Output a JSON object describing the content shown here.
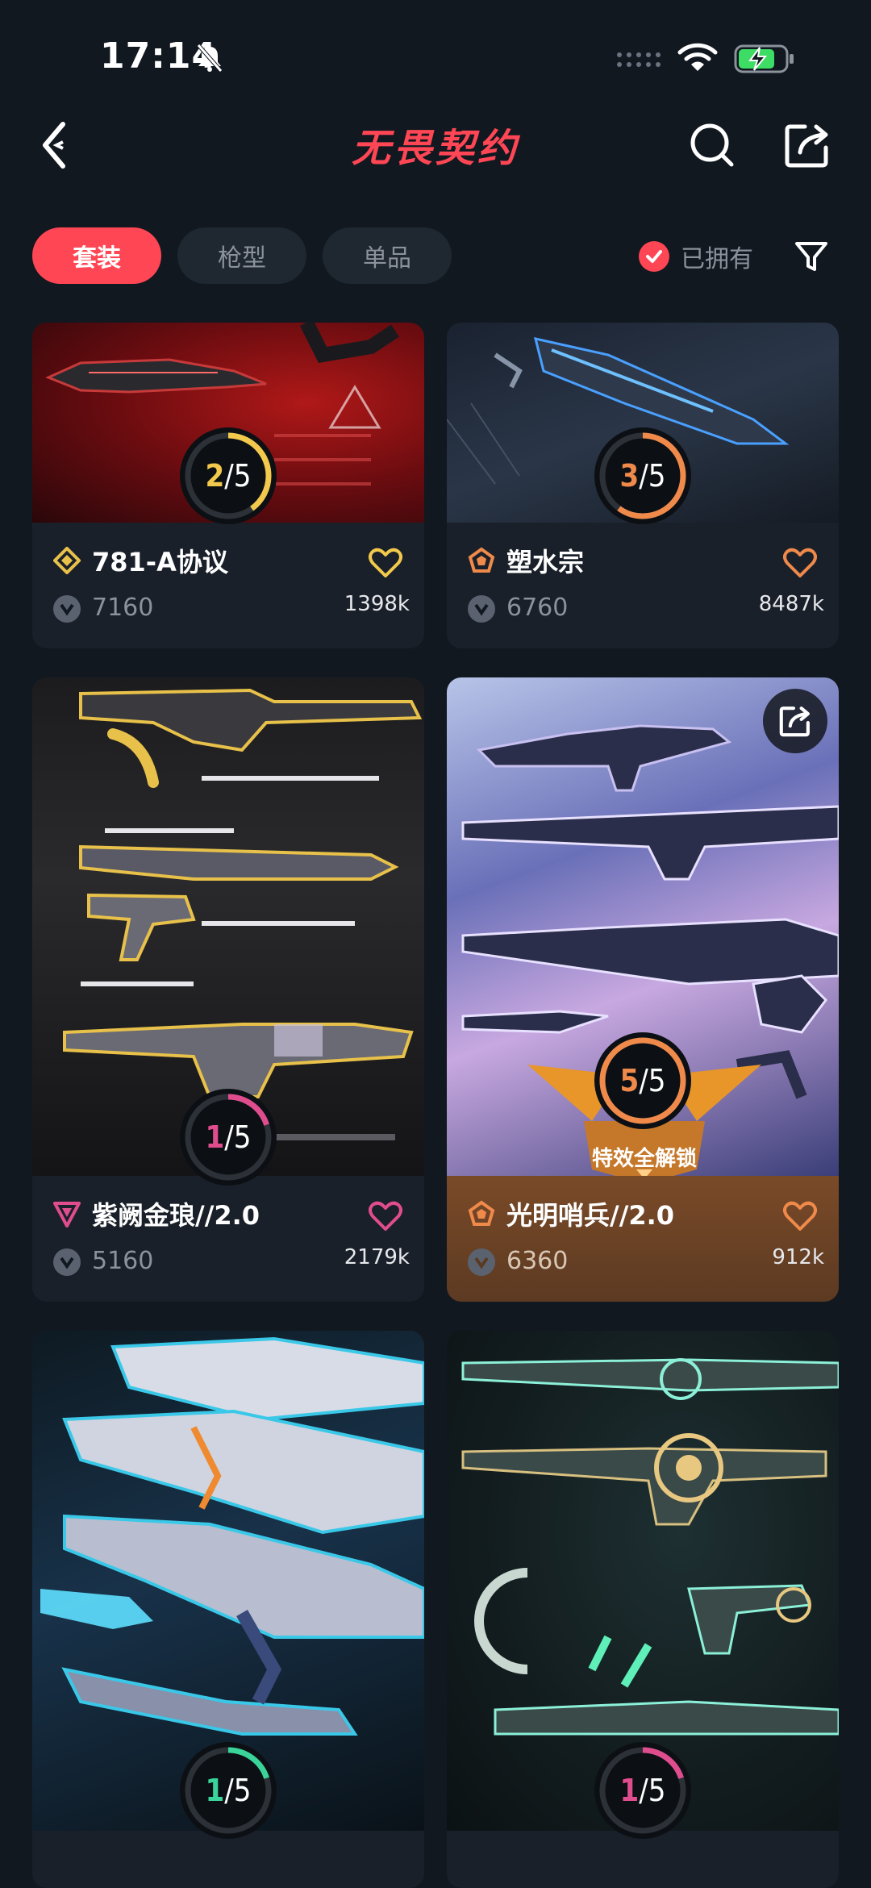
{
  "status": {
    "time": "17:14"
  },
  "header": {
    "title": "无畏契约"
  },
  "tabs": [
    {
      "label": "套装",
      "active": true
    },
    {
      "label": "枪型",
      "active": false
    },
    {
      "label": "单品",
      "active": false
    }
  ],
  "filter": {
    "owned_label": "已拥有",
    "owned_checked": true
  },
  "colors": {
    "accent": "#ff4655",
    "background": "#111820",
    "card": "#1a2029"
  },
  "cards": [
    {
      "name": "781-A协议",
      "price": "7160",
      "likes": "1398k",
      "progress": {
        "owned": "2",
        "total": "5"
      },
      "tier_color": "#e8c14a",
      "ring_color": "#f2c94c"
    },
    {
      "name": "塑水宗",
      "price": "6760",
      "likes": "8487k",
      "progress": {
        "owned": "3",
        "total": "5"
      },
      "tier_color": "#f08a4b",
      "ring_color": "#f08a4b"
    },
    {
      "name": "紫阙金琅//2.0",
      "price": "5160",
      "likes": "2179k",
      "progress": {
        "owned": "1",
        "total": "5"
      },
      "tier_color": "#e04d8e",
      "ring_color": "#e04d8e"
    },
    {
      "name": "光明哨兵//2.0",
      "price": "6360",
      "likes": "912k",
      "progress": {
        "owned": "5",
        "total": "5"
      },
      "tier_color": "#f08a4b",
      "ring_color": "#f08a4b",
      "badge": "特效全解锁"
    },
    {
      "progress": {
        "owned": "1",
        "total": "5"
      },
      "ring_color": "#3ad39a"
    },
    {
      "progress": {
        "owned": "1",
        "total": "5"
      },
      "ring_color": "#e04d8e"
    }
  ]
}
